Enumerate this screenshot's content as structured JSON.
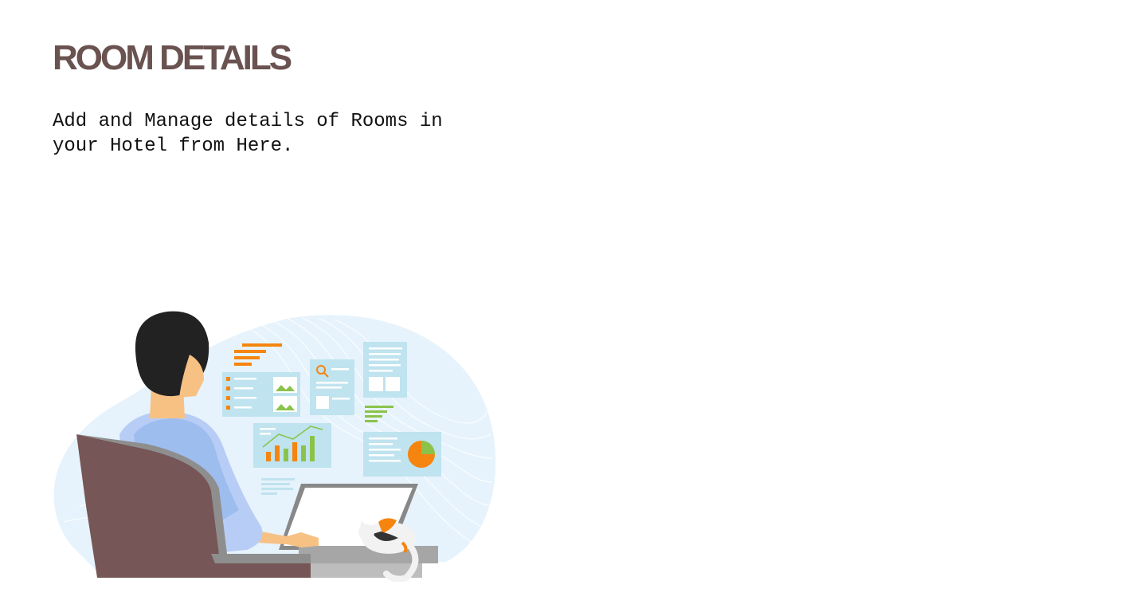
{
  "header": {
    "title": "ROOM DETAILS",
    "description": "Add and Manage details of Rooms in your Hotel from Here."
  },
  "illustration": {
    "icon": "person-at-laptop-dashboard-illustration"
  },
  "colors": {
    "title": "#6a5250",
    "chair": "#765656",
    "blob": "#e6f3fc",
    "panel": "#bfe3ef",
    "orange": "#f5850f",
    "green": "#8bc34a"
  }
}
